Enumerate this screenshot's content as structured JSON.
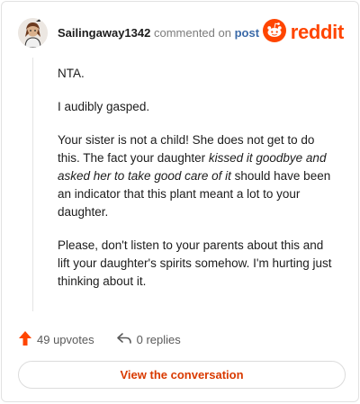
{
  "header": {
    "username": "Sailingaway1342",
    "action_text": "commented on",
    "post_link": "post",
    "brand_name": "reddit"
  },
  "comment": {
    "paragraph_1": "NTA.",
    "paragraph_2": "I audibly gasped.",
    "paragraph_3_part_1": "Your sister is not a child! She does not get to do this. The fact your daughter ",
    "paragraph_3_emphasis": "kissed it goodbye and asked her to take good care of it",
    "paragraph_3_part_2": " should have been an indicator that this plant meant a lot to your daughter.",
    "paragraph_4": "Please, don't listen to your parents about this and lift your daughter's spirits somehow. I'm hurting just thinking about it."
  },
  "footer": {
    "upvotes": "49 upvotes",
    "replies": "0 replies"
  },
  "cta": {
    "label": "View the conversation"
  },
  "colors": {
    "brand": "#ff4500",
    "link": "#3b6aa8",
    "cta_text": "#d93a00"
  },
  "icons": {
    "avatar": "user-avatar-icon",
    "brand": "reddit-logo-icon",
    "upvote": "upvote-arrow-icon",
    "reply": "reply-arrow-icon"
  }
}
